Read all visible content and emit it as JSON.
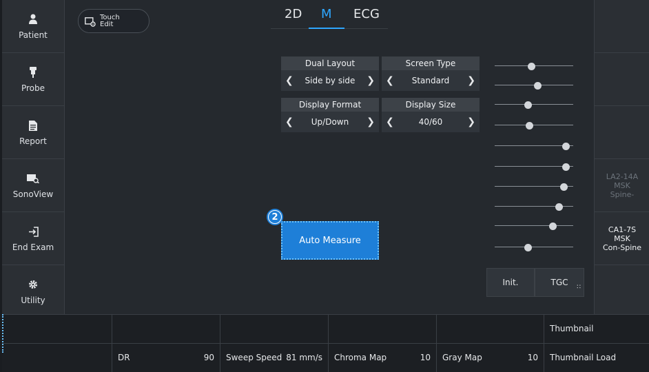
{
  "sidebar": {
    "items": [
      {
        "label": "Patient",
        "icon": "person-icon"
      },
      {
        "label": "Probe",
        "icon": "probe-icon"
      },
      {
        "label": "Report",
        "icon": "document-icon"
      },
      {
        "label": "SonoView",
        "icon": "image-search-icon"
      },
      {
        "label": "End Exam",
        "icon": "exit-icon"
      },
      {
        "label": "Utility",
        "icon": "gear-icon"
      }
    ]
  },
  "touch_edit": {
    "line1": "Touch",
    "line2": "Edit"
  },
  "tabs": {
    "items": [
      "2D",
      "M",
      "ECG"
    ],
    "active": "M"
  },
  "settings": {
    "dual_layout": {
      "title": "Dual Layout",
      "value": "Side by side"
    },
    "screen_type": {
      "title": "Screen Type",
      "value": "Standard"
    },
    "display_format": {
      "title": "Display Format",
      "value": "Up/Down"
    },
    "display_size": {
      "title": "Display Size",
      "value": "40/60"
    }
  },
  "tgc": {
    "levels": [
      0.47,
      0.55,
      0.42,
      0.44,
      0.95,
      0.95,
      0.92,
      0.85,
      0.77,
      0.42
    ],
    "init_label": "Init.",
    "tgc_label": "TGC"
  },
  "auto_measure": {
    "label": "Auto Measure",
    "step": "2"
  },
  "probes": [
    {
      "line1": "LA2-14A",
      "line2": "MSK",
      "line3": "Spine-",
      "active": false
    },
    {
      "line1": "CA1-7S",
      "line2": "MSK",
      "line3": "Con-Spine",
      "active": true
    }
  ],
  "bottom": {
    "dr": {
      "label": "DR",
      "value": "90"
    },
    "sweep_speed": {
      "label": "Sweep Speed",
      "value": "81 mm/s"
    },
    "chroma_map": {
      "label": "Chroma Map",
      "value": "10"
    },
    "gray_map": {
      "label": "Gray Map",
      "value": "10"
    },
    "thumbnail": "Thumbnail",
    "thumbnail_load": "Thumbnail Load"
  },
  "colors": {
    "accent": "#2ea7ff",
    "button_blue": "#1e7fd8",
    "background": "#25292e"
  }
}
